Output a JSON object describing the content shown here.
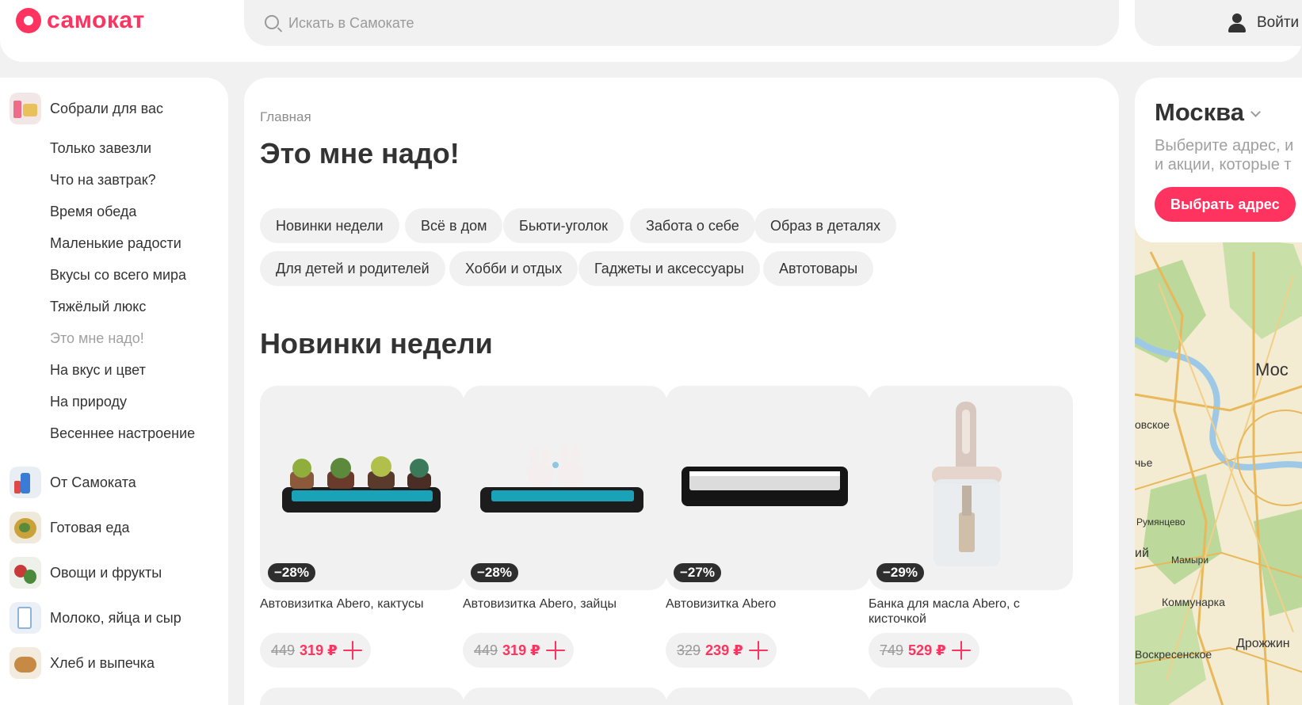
{
  "header": {
    "brand": "самокат",
    "search_placeholder": "Искать в Самокате",
    "login_label": "Войти"
  },
  "sidebar": {
    "groups": [
      {
        "label": "Собрали для вас",
        "subitems": [
          "Только завезли",
          "Что на завтрак?",
          "Время обеда",
          "Маленькие радости",
          "Вкусы со всего мира",
          "Тяжёлый люкс",
          "Это мне надо!",
          "На вкус и цвет",
          "На природу",
          "Весеннее настроение"
        ],
        "active": "Это мне надо!"
      }
    ],
    "categories": [
      "От Самоката",
      "Готовая еда",
      "Овощи и фрукты",
      "Молоко, яйца и сыр",
      "Хлеб и выпечка"
    ]
  },
  "main": {
    "breadcrumb": "Главная",
    "title": "Это мне надо!",
    "chips": [
      "Новинки недели",
      "Всё в дом",
      "Бьюти-уголок",
      "Забота о себе",
      "Образ в деталях",
      "Для детей и родителей",
      "Хобби и отдых",
      "Гаджеты и аксессуары",
      "Автотовары"
    ],
    "section_title": "Новинки недели",
    "products": [
      {
        "name": "Автовизитка Abero, кактусы",
        "discount": "−28%",
        "old_price": "449",
        "price": "319 ₽"
      },
      {
        "name": "Автовизитка Abero, зайцы",
        "discount": "−28%",
        "old_price": "449",
        "price": "319 ₽"
      },
      {
        "name": "Автовизитка Abero",
        "discount": "−27%",
        "old_price": "329",
        "price": "239 ₽"
      },
      {
        "name": "Банка для масла Abero, с кисточкой",
        "discount": "−29%",
        "old_price": "749",
        "price": "529 ₽"
      }
    ]
  },
  "location": {
    "city": "Москва",
    "hint_line1": "Выберите адрес, и",
    "hint_line2": "и акции, которые т",
    "button_label": "Выбрать адрес",
    "map_labels": [
      "Мос",
      "овское",
      "чье",
      "Румянцево",
      "ий",
      "Мамыри",
      "Коммунарка",
      "Дрожжин",
      "Воскресенское"
    ]
  },
  "colors": {
    "accent": "#ff335f",
    "text": "#333333",
    "muted": "#9a9a9a",
    "surface": "#f1f1f1"
  }
}
